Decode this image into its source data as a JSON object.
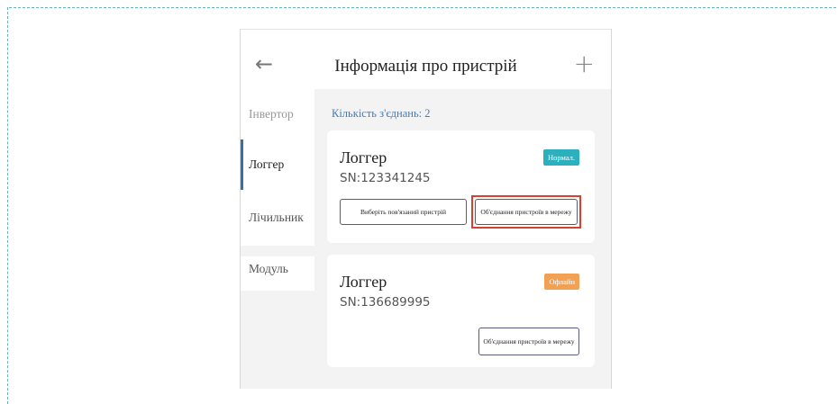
{
  "header": {
    "title": "Інформація про пристрій",
    "back_icon": "←",
    "add_icon": "+"
  },
  "sidebar": {
    "items": [
      {
        "label": "Інвертор"
      },
      {
        "label": "Логгер"
      },
      {
        "label": "Лічильник"
      },
      {
        "label": "Модуль"
      }
    ],
    "active": "Логгер"
  },
  "main": {
    "connections_label": "Кількість з'єднань: 2",
    "devices": [
      {
        "name": "Логгер",
        "sn": "SN:123341245",
        "status": "Нормал.",
        "status_color": "#2ab1bd",
        "select_button": "Виберіть пов'язаний пристрій",
        "network_button": "Об'єднання пристроїв в мережу"
      },
      {
        "name": "Логгер",
        "sn": "SN:136689995",
        "status": "Офлайн",
        "status_color": "#f2a154",
        "network_button": "Об'єднання пристроїв в мережу"
      }
    ]
  },
  "colors": {
    "accent": "#3a6ea8",
    "highlight": "#d9412e",
    "link": "#4a7bb0"
  }
}
